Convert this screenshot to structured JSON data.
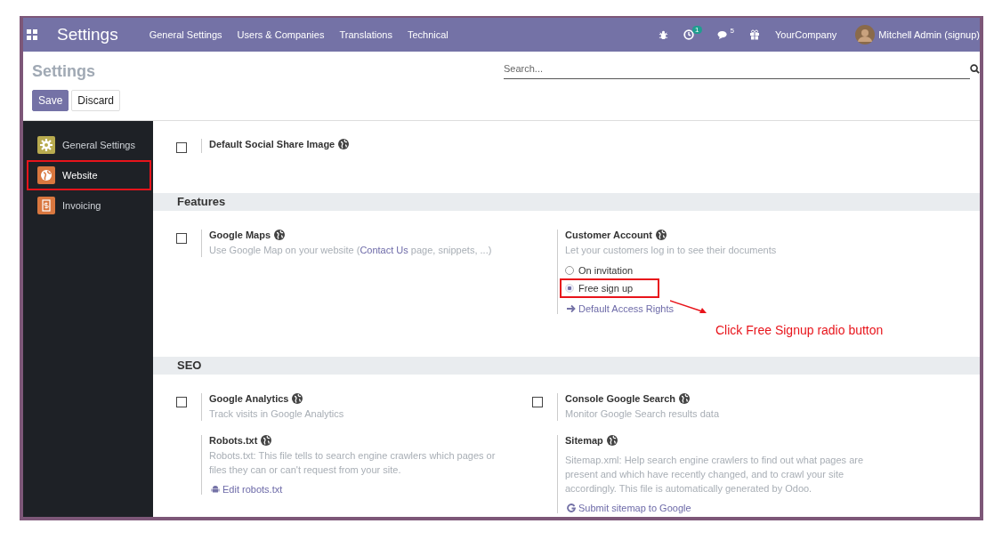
{
  "navbar": {
    "app_title": "Settings",
    "menu": [
      "General Settings",
      "Users & Companies",
      "Translations",
      "Technical"
    ],
    "activity_count": "1",
    "message_count": "5",
    "company": "YourCompany",
    "user": "Mitchell Admin (signup)"
  },
  "control_panel": {
    "title": "Settings",
    "search": {
      "placeholder": "Search..."
    },
    "buttons": [
      {
        "label": "Save",
        "kind": "primary"
      },
      {
        "label": "Discard",
        "kind": "secondary"
      }
    ]
  },
  "sidebar": {
    "items": [
      {
        "label": "General Settings",
        "kind": "gear",
        "color": "#b8ab4f",
        "selected": false,
        "highlighted": false
      },
      {
        "label": "Website",
        "kind": "globe",
        "color": "#d9773f",
        "selected": true,
        "highlighted": true
      },
      {
        "label": "Invoicing",
        "kind": "invoice",
        "color": "#d9773f",
        "selected": false,
        "highlighted": false
      }
    ]
  },
  "sections": [
    {
      "columns": [
        [
          {
            "title": "Default Social Share Image",
            "globe": true,
            "checkbox": {
              "checked": false
            }
          }
        ],
        []
      ]
    },
    {
      "title": "Features",
      "columns": [
        [
          {
            "title": "Google Maps",
            "globe": true,
            "checkbox": {
              "checked": false
            },
            "description": [
              {
                "kind": "text",
                "text": "Use Google Map on your website ("
              },
              {
                "kind": "link",
                "text": "Contact Us"
              },
              {
                "kind": "text",
                "text": " page, snippets, ...)"
              }
            ]
          }
        ],
        [
          {
            "title": "Customer Account",
            "globe": true,
            "description": [
              {
                "kind": "text",
                "text": "Let your customers log in to see their documents"
              }
            ],
            "options": [
              {
                "label": "On invitation",
                "selected": false,
                "highlighted": false
              },
              {
                "label": "Free sign up",
                "selected": true,
                "highlighted": true
              }
            ],
            "link": {
              "kind": "arrow",
              "label": "Default Access Rights"
            }
          }
        ]
      ],
      "annotation": "Click Free Signup radio button"
    },
    {
      "title": "SEO",
      "columns": [
        [
          {
            "title": "Google Analytics",
            "globe": true,
            "checkbox": {
              "checked": false
            },
            "description": [
              {
                "kind": "text",
                "text": "Track visits in Google Analytics"
              }
            ]
          },
          {
            "title": "Robots.txt",
            "globe": true,
            "description": [
              {
                "kind": "text",
                "text": "Robots.txt: This file tells to search engine crawlers which pages or files they can or can't request from your site."
              }
            ],
            "link": {
              "kind": "robot",
              "label": "Edit robots.txt"
            }
          }
        ],
        [
          {
            "title": "Console Google Search",
            "globe": true,
            "checkbox": {
              "checked": false
            },
            "description": [
              {
                "kind": "text",
                "text": "Monitor Google Search results data"
              }
            ]
          },
          {
            "title": "Sitemap",
            "globe": true,
            "description": [
              {
                "kind": "text",
                "text": "Sitemap.xml: Help search engine crawlers to find out what pages are present and which have recently changed, and to crawl your site accordingly. This file is automatically generated by Odoo."
              }
            ],
            "link": {
              "kind": "google",
              "label": "Submit sitemap to Google"
            }
          }
        ]
      ]
    }
  ]
}
